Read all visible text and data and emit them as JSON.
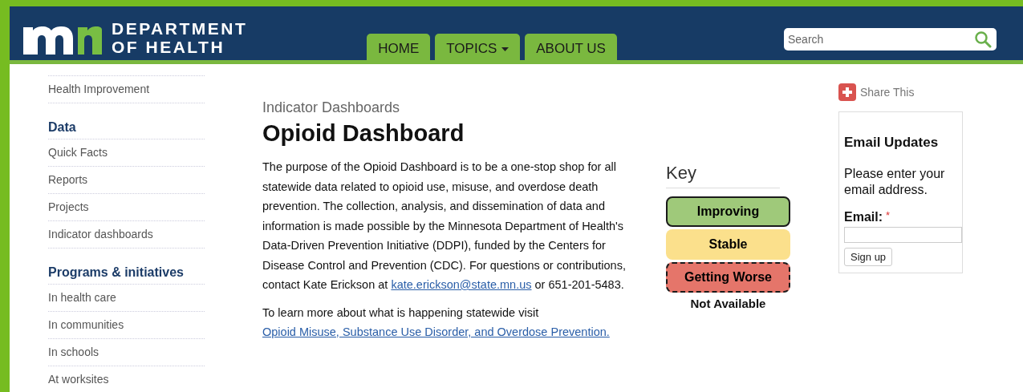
{
  "header": {
    "logo_line1": "DEPARTMENT",
    "logo_line2": "OF HEALTH",
    "nav": [
      {
        "label": "HOME",
        "dropdown": false
      },
      {
        "label": "TOPICS",
        "dropdown": true
      },
      {
        "label": "ABOUT US",
        "dropdown": false
      }
    ],
    "search": {
      "placeholder": "Search"
    }
  },
  "sidebar": {
    "top_link": "Health Improvement",
    "sections": [
      {
        "title": "Data",
        "items": [
          "Quick Facts",
          "Reports",
          "Projects",
          "Indicator dashboards"
        ]
      },
      {
        "title": "Programs & initiatives",
        "items": [
          "In health care",
          "In communities",
          "In schools",
          "At worksites"
        ]
      }
    ]
  },
  "main": {
    "breadcrumb": "Indicator Dashboards",
    "title": "Opioid Dashboard",
    "paragraph1": {
      "text": "The purpose of the Opioid Dashboard is to be a one-stop shop for all statewide data related to opioid use, misuse, and overdose death prevention.  The collection, analysis, and dissemination of data and information is made possible by the Minnesota Department of Health's Data-Driven Prevention Initiative (DDPI), funded by the Centers for Disease Control and Prevention (CDC). For questions or contributions, contact Kate Erickson at",
      "link": "kate.erickson@state.mn.us",
      "after": " or 651-201-5483."
    },
    "paragraph2": {
      "text": "To learn more about what is happening statewide visit",
      "link": "Opioid Misuse, Substance Use Disorder, and Overdose Prevention."
    }
  },
  "key": {
    "title": "Key",
    "items": [
      {
        "label": "Improving",
        "kind": "solid",
        "color": "#9fc97a"
      },
      {
        "label": "Stable",
        "kind": "plain",
        "color": "#fbe08c"
      },
      {
        "label": "Getting Worse",
        "kind": "dashed",
        "color": "#e5756a"
      },
      {
        "label": "Not Available",
        "kind": "none"
      }
    ]
  },
  "aside": {
    "share": "Share This",
    "email_box": {
      "title": "Email Updates",
      "text": "Please enter your email address.",
      "field_label": "Email:",
      "required_mark": "*",
      "button": "Sign up"
    }
  }
}
